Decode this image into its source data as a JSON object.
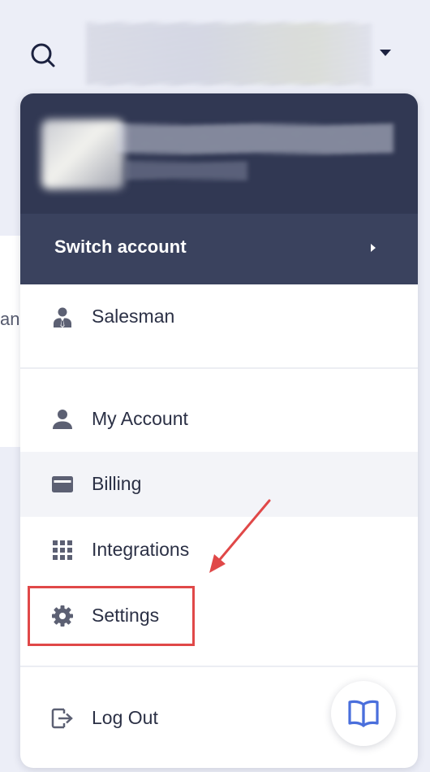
{
  "menu": {
    "switch_account": "Switch account",
    "items": [
      {
        "label": "Salesman",
        "icon": "salesman-icon"
      },
      {
        "label": "My Account",
        "icon": "user-icon"
      },
      {
        "label": "Billing",
        "icon": "credit-card-icon"
      },
      {
        "label": "Integrations",
        "icon": "grid-icon"
      },
      {
        "label": "Settings",
        "icon": "gear-icon"
      },
      {
        "label": "Log Out",
        "icon": "logout-icon"
      }
    ]
  },
  "background": {
    "partial_text": "ans"
  },
  "colors": {
    "header_bg": "#313853",
    "switch_bg": "#3a425e",
    "annotation_red": "#e04848",
    "icon_gray": "#5c6073",
    "help_blue": "#4a6fdc"
  }
}
